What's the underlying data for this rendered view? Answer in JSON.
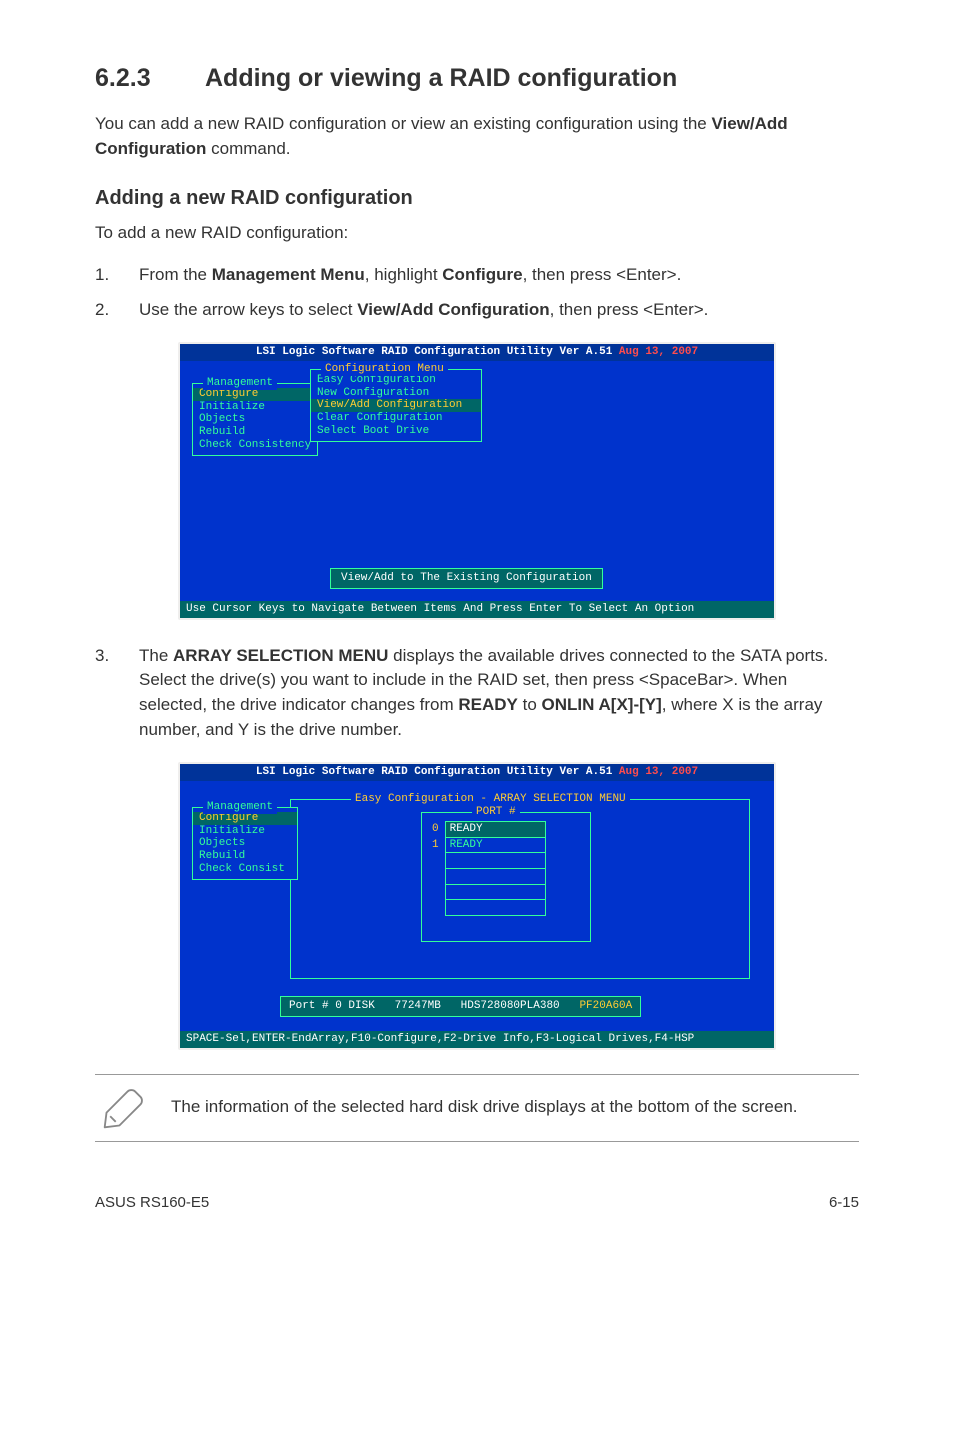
{
  "section": {
    "number": "6.2.3",
    "title": "Adding or viewing a RAID configuration"
  },
  "intro": {
    "p1_a": "You can add a new RAID configuration or view an existing configuration using the ",
    "p1_b": "View/Add Configuration",
    "p1_c": " command."
  },
  "subheading": "Adding a new RAID configuration",
  "subintro": "To add a new RAID configuration:",
  "steps12": {
    "s1": {
      "n": "1.",
      "a": "From the ",
      "b": "Management Menu",
      "c": ", highlight ",
      "d": "Configure",
      "e": ", then press <Enter>."
    },
    "s2": {
      "n": "2.",
      "a": "Use the arrow keys to select ",
      "b": "View/Add Configuration",
      "c": ", then press <Enter>."
    }
  },
  "bios1": {
    "title_a": "LSI Logic Software RAID Configuration Utility Ver A.51 ",
    "title_b": "Aug 13, 2007",
    "mgmt_title": "Management",
    "mgmt": [
      "Configure",
      "Initialize",
      "Objects",
      "Rebuild",
      "Check Consistency"
    ],
    "cfg_title": "Configuration Menu",
    "cfg_items": [
      "Easy Configuration",
      "New Configuration",
      "View/Add Configuration",
      "Clear Configuration",
      "Select Boot Drive"
    ],
    "button": "View/Add to The Existing Configuration",
    "footer": "Use Cursor Keys to Navigate Between Items And Press Enter To Select An Option"
  },
  "step3": {
    "n": "3.",
    "t1": "The ",
    "b1": "ARRAY SELECTION MENU",
    "t2": " displays the available drives connected to the SATA ports. Select the drive(s) you want to include in the RAID set, then press <SpaceBar>. When selected, the drive indicator changes from ",
    "b2": "READY",
    "t3": " to ",
    "b3": "ONLIN A[X]-[Y]",
    "t4": ", where X is the array number, and Y is the drive number."
  },
  "bios2": {
    "title_a": "LSI Logic Software RAID Configuration Utility Ver A.51 ",
    "title_b": "Aug 13, 2007",
    "mgmt_title": "Management",
    "mgmt": [
      "Configure",
      "Initialize",
      "Objects",
      "Rebuild",
      "Check Consist"
    ],
    "outer_title": "Easy Configuration - ARRAY SELECTION MENU",
    "port_header": "PORT #",
    "rows": [
      {
        "n": "0",
        "v": "READY"
      },
      {
        "n": "1",
        "v": "READY"
      }
    ],
    "status": {
      "a": "Port # 0 DISK   77247MB   HDS728080PLA380   ",
      "b": "PF20A60A"
    },
    "footer": "SPACE-Sel,ENTER-EndArray,F10-Configure,F2-Drive Info,F3-Logical Drives,F4-HSP"
  },
  "note": "The information of the selected hard disk drive displays at the bottom of the screen.",
  "footer": {
    "left": "ASUS RS160-E5",
    "right": "6-15"
  }
}
